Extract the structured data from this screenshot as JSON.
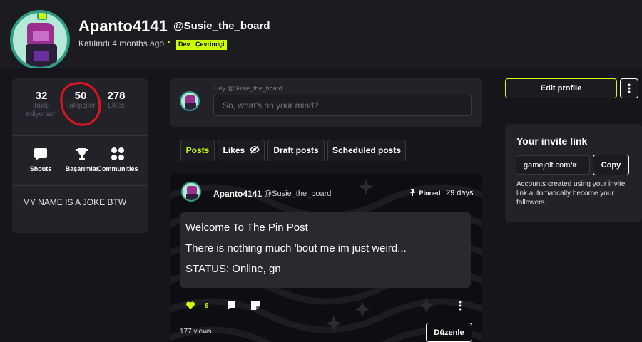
{
  "profile": {
    "username": "Apanto4141",
    "handle": "@Susie_the_board",
    "joined": "Katılındı 4 months ago",
    "tags": [
      "Dev",
      "Çevrimiçi"
    ]
  },
  "stats": {
    "following_count": "32",
    "following_label": "Takip ediyorsun",
    "followers_count": "50",
    "followers_label": "Takipçiler",
    "likes_count": "278",
    "likes_label": "Likes"
  },
  "quick_links": {
    "shouts": "Shouts",
    "achievements": "Başarımlar",
    "communities": "Communities"
  },
  "bio": "MY NAME IS A JOKE BTW",
  "composer": {
    "greeting": "Hey @Susie_the_board",
    "placeholder": "So, what's on your mind?"
  },
  "tabs": [
    "Posts",
    "Likes",
    "Draft posts",
    "Scheduled posts"
  ],
  "post": {
    "author": "Apanto4141",
    "handle": "@Susie_the_board",
    "pinned_label": "Pinned",
    "age": "29 days",
    "lines": [
      "Welcome To The Pin Post",
      "There is nothing much 'bout me im just weird...",
      "STATUS: Online, gn"
    ],
    "like_count": "6",
    "views": "177 views",
    "edit_label": "Düzenle"
  },
  "sidebar": {
    "edit_profile_label": "Edit profile",
    "invite_title": "Your invite link",
    "invite_value": "gamejolt.com/ir",
    "copy_label": "Copy",
    "invite_desc": "Accounts created using your invite link automatically become your followers."
  },
  "colors": {
    "accent": "#ccff00",
    "annotation": "#e0141e",
    "background": "#1c1b20",
    "card": "#232228"
  }
}
